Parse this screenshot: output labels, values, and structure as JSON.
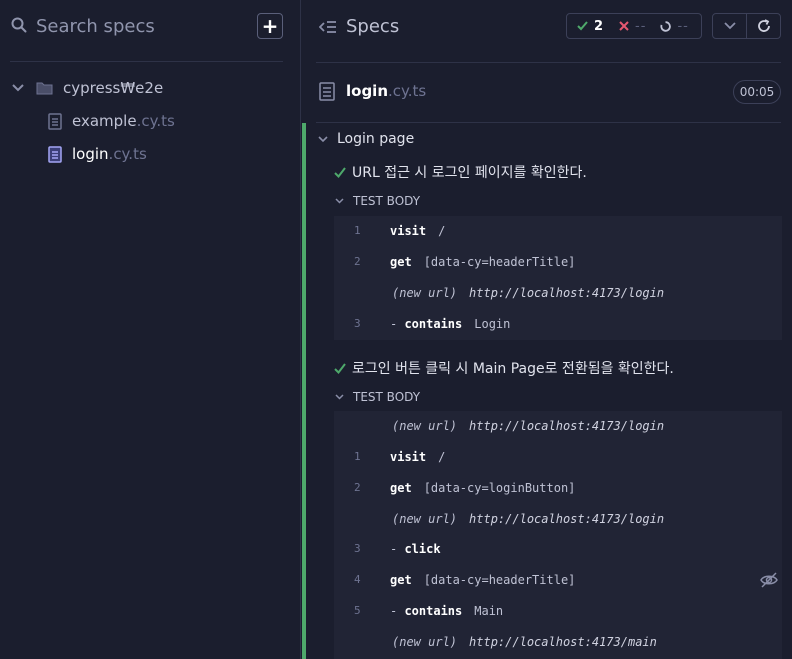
{
  "sidebar": {
    "search": {
      "placeholder": "Search specs"
    },
    "add_label": "+",
    "tree": {
      "folder": "cypress₩e2e",
      "files": [
        {
          "name": "example",
          "ext": ".cy.ts"
        },
        {
          "name": "login",
          "ext": ".cy.ts"
        }
      ]
    }
  },
  "header": {
    "title": "Specs",
    "stats": {
      "passed": "2",
      "failed": "--",
      "pending": "--"
    }
  },
  "file": {
    "name": "login",
    "ext": ".cy.ts",
    "duration": "00:05"
  },
  "suite": {
    "title": "Login page",
    "tests": [
      {
        "title": "URL 접근 시 로그인 페이지를 확인한다.",
        "body_label": "TEST BODY",
        "commands": [
          {
            "num": "1",
            "name": "visit",
            "message": "/"
          },
          {
            "num": "2",
            "name": "get",
            "message": "[data-cy=headerTitle]"
          },
          {
            "event": "(new url)",
            "url": "http://localhost:4173/login"
          },
          {
            "num": "3",
            "name": "contains",
            "message": "Login"
          }
        ]
      },
      {
        "title": "로그인 버튼 클릭 시 Main Page로 전환됨을 확인한다.",
        "body_label": "TEST BODY",
        "commands": [
          {
            "event": "(new url)",
            "url": "http://localhost:4173/login"
          },
          {
            "num": "1",
            "name": "visit",
            "message": "/"
          },
          {
            "num": "2",
            "name": "get",
            "message": "[data-cy=loginButton]"
          },
          {
            "event": "(new url)",
            "url": "http://localhost:4173/login"
          },
          {
            "num": "3",
            "name": "click",
            "message": ""
          },
          {
            "num": "4",
            "name": "get",
            "message": "[data-cy=headerTitle]"
          },
          {
            "num": "5",
            "name": "contains",
            "message": "Main"
          },
          {
            "event": "(new url)",
            "url": "http://localhost:4173/main"
          }
        ]
      }
    ]
  },
  "colors": {
    "pass": "#4ea96b",
    "fail": "#e45770",
    "accent": "#a4a6f6"
  }
}
